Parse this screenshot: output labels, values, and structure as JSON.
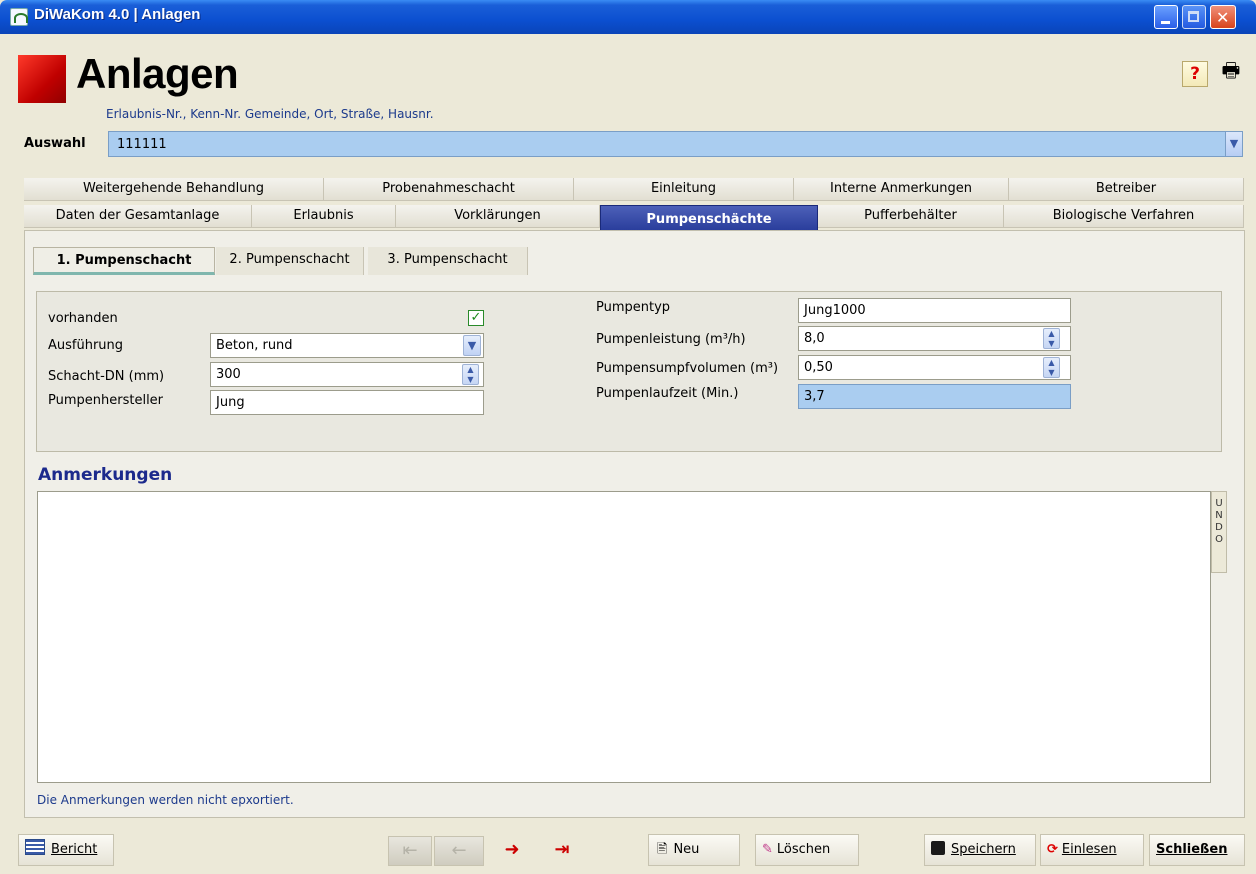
{
  "window": {
    "title": "DiWaKom 4.0  |  Anlagen"
  },
  "header": {
    "title": "Anlagen",
    "subtitle": "Erlaubnis-Nr., Kenn-Nr. Gemeinde, Ort, Straße, Hausnr.",
    "help_glyph": "?",
    "print_glyph": "🖶"
  },
  "selector": {
    "label": "Auswahl",
    "value": "111111"
  },
  "tabs_row1": [
    "Weitergehende Behandlung",
    "Probenahmeschacht",
    "Einleitung",
    "Interne Anmerkungen",
    "Betreiber"
  ],
  "tabs_row2": [
    "Daten der Gesamtanlage",
    "Erlaubnis",
    "Vorklärungen",
    "Pumpenschächte",
    "Pufferbehälter",
    "Biologische Verfahren"
  ],
  "active_tab": "Pumpenschächte",
  "subtabs": [
    "1. Pumpenschacht",
    "2. Pumpenschacht",
    "3. Pumpenschacht"
  ],
  "form": {
    "vorhanden_label": "vorhanden",
    "vorhanden_checked": true,
    "ausfuehrung_label": "Ausführung",
    "ausfuehrung_value": "Beton, rund",
    "schacht_dn_label": "Schacht-DN (mm)",
    "schacht_dn_value": "300",
    "hersteller_label": "Pumpenhersteller",
    "hersteller_value": "Jung",
    "pumpentyp_label": "Pumpentyp",
    "pumpentyp_value": "Jung1000",
    "leistung_label": "Pumpenleistung (m³/h)",
    "leistung_value": "8,0",
    "sumpf_label": "Pumpensumpfvolumen (m³)",
    "sumpf_value": "0,50",
    "laufzeit_label": "Pumpenlaufzeit (Min.)",
    "laufzeit_value": "3,7"
  },
  "notes": {
    "title": "Anmerkungen",
    "undo_label": "UNDO",
    "note": "Die Anmerkungen werden nicht epxortiert."
  },
  "toolbar": {
    "bericht": "Bericht",
    "neu": "Neu",
    "loeschen": "Löschen",
    "speichern": "Speichern",
    "einlesen": "Einlesen",
    "schliessen": "Schließen"
  },
  "colors": {
    "active_tab": "#2a3e9c",
    "calc_field": "#aacdf0",
    "title_bar": "#0b4fd0",
    "accent_red": "#c00000"
  }
}
